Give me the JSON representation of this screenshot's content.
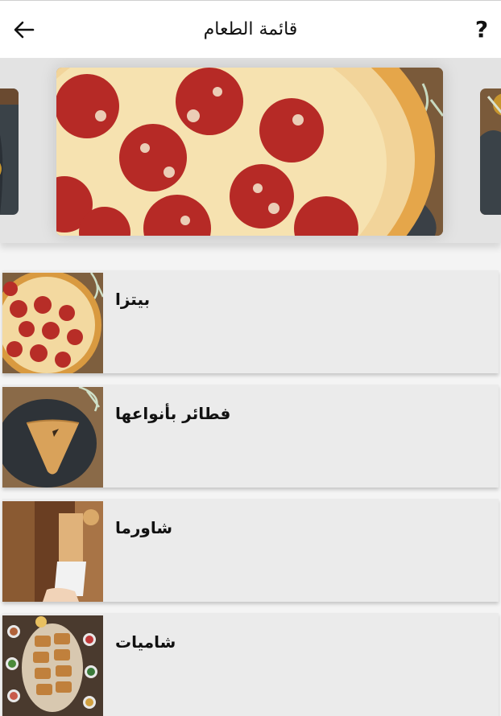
{
  "app_bar": {
    "title": "قائمة الطعام",
    "back_icon": "arrow-left-icon",
    "help_label": "?"
  },
  "carousel": {
    "slides": [
      "pizza-pepperoni-banner"
    ],
    "active_index": 0
  },
  "menu": {
    "categories": [
      {
        "name": "بيتزا",
        "image": "pepperoni-pizza-photo"
      },
      {
        "name": "فطائر بأنواعها",
        "image": "triangle-pie-photo"
      },
      {
        "name": "شاورما",
        "image": "shawarma-wrap-photo"
      },
      {
        "name": "شاميات",
        "image": "levantine-pastries-photo"
      }
    ]
  },
  "colors": {
    "app_bar_bg": "#ffffff",
    "page_bg": "#f4f4f4",
    "card_bg": "#ebebeb",
    "carousel_bg": "#e3e3e3"
  }
}
